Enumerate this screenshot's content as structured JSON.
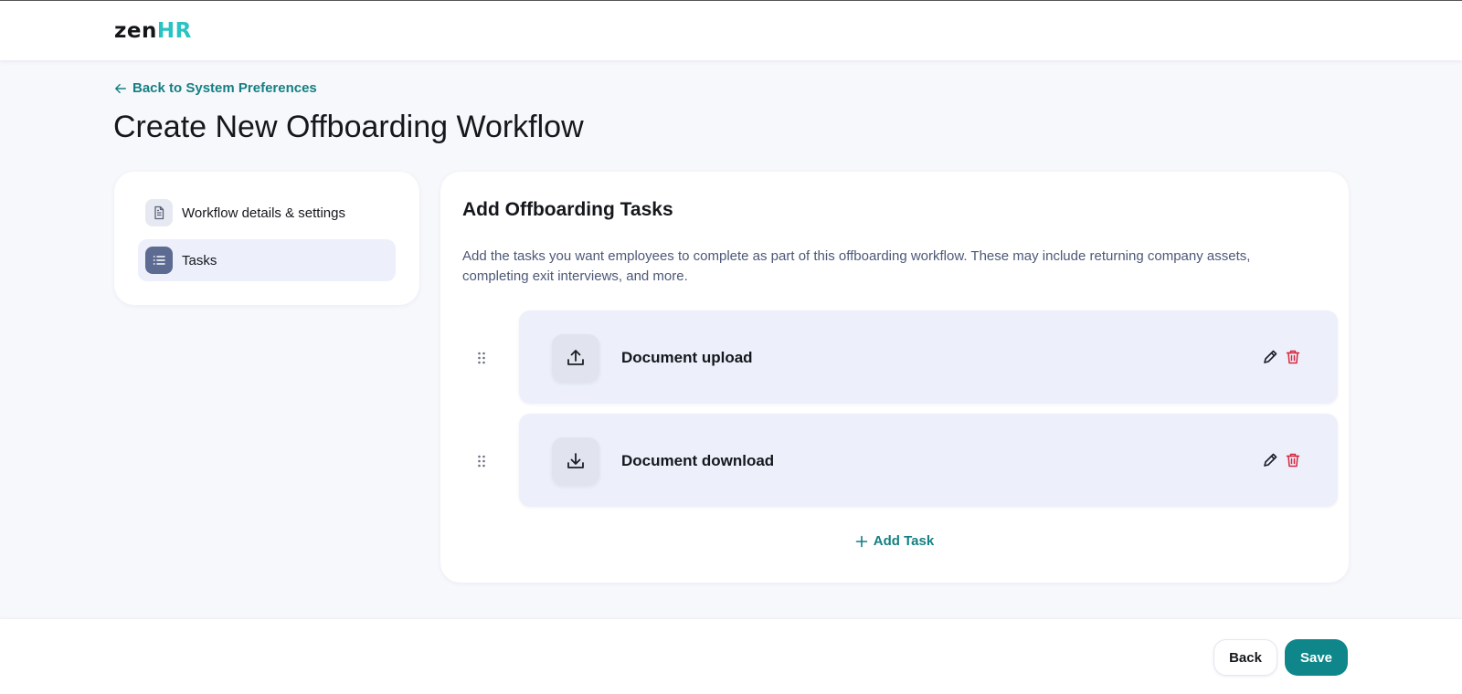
{
  "brand": {
    "logo_part1": "zen",
    "logo_part2": "HR"
  },
  "nav": {
    "back_link": "Back to System Preferences"
  },
  "page": {
    "title": "Create New Offboarding Workflow"
  },
  "sidebar": {
    "items": [
      {
        "label": "Workflow details & settings",
        "icon": "document-icon",
        "active": false
      },
      {
        "label": "Tasks",
        "icon": "list-icon",
        "active": true
      }
    ]
  },
  "main": {
    "title": "Add Offboarding Tasks",
    "description": "Add the tasks you want employees to complete as part of this offboarding workflow. These may include returning company assets, completing exit interviews, and more.",
    "tasks": [
      {
        "label": "Document upload",
        "icon": "upload-icon"
      },
      {
        "label": "Document download",
        "icon": "download-icon"
      }
    ],
    "add_task_label": "Add Task"
  },
  "footer": {
    "back_label": "Back",
    "save_label": "Save"
  },
  "colors": {
    "accent": "#0f878a",
    "brand_hr": "#2ac3c3",
    "danger": "#d7263d",
    "active_bg": "#edf0fb"
  }
}
